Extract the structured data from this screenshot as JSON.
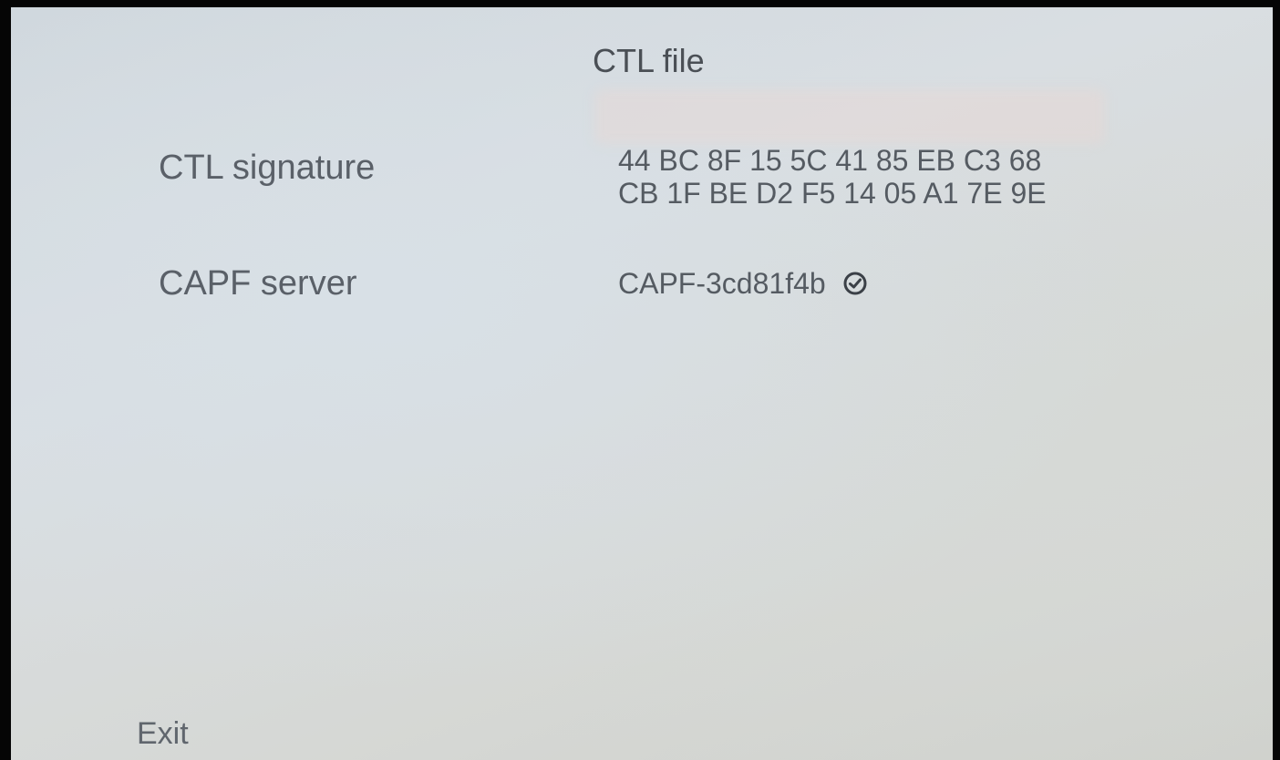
{
  "header": {
    "title": "CTL file"
  },
  "fields": {
    "ctl_signature": {
      "label": "CTL signature",
      "value_line1": "44 BC 8F 15 5C 41 85 EB C3 68",
      "value_line2": "CB 1F BE D2 F5 14 05 A1 7E 9E"
    },
    "capf_server": {
      "label": "CAPF server",
      "value": "CAPF-3cd81f4b",
      "status_icon": "check-circle-icon"
    }
  },
  "footer": {
    "exit_label": "Exit"
  }
}
